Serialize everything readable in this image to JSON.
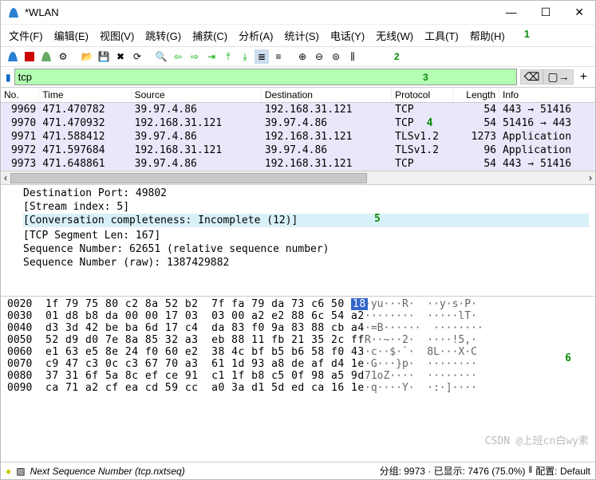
{
  "window": {
    "title": "*WLAN"
  },
  "menu": {
    "file": "文件(F)",
    "edit": "编辑(E)",
    "view": "视图(V)",
    "go": "跳转(G)",
    "capture": "捕获(C)",
    "analyze": "分析(A)",
    "stats": "统计(S)",
    "tel": "电话(Y)",
    "wireless": "无线(W)",
    "tools": "工具(T)",
    "help": "帮助(H)"
  },
  "annotations": {
    "n1": "1",
    "n2": "2",
    "n3": "3",
    "n4": "4",
    "n5": "5",
    "n6": "6"
  },
  "filter": {
    "value": "tcp"
  },
  "columns": {
    "no": "No.",
    "time": "Time",
    "src": "Source",
    "dst": "Destination",
    "proto": "Protocol",
    "len": "Length",
    "info": "Info"
  },
  "packets": [
    {
      "no": "9969",
      "time": "471.470782",
      "src": "39.97.4.86",
      "dst": "192.168.31.121",
      "proto": "TCP",
      "len": "54",
      "info": "443 → 51416"
    },
    {
      "no": "9970",
      "time": "471.470932",
      "src": "192.168.31.121",
      "dst": "39.97.4.86",
      "proto": "TCP",
      "len": "54",
      "info": "51416 → 443"
    },
    {
      "no": "9971",
      "time": "471.588412",
      "src": "39.97.4.86",
      "dst": "192.168.31.121",
      "proto": "TLSv1.2",
      "len": "1273",
      "info": "Application"
    },
    {
      "no": "9972",
      "time": "471.597684",
      "src": "192.168.31.121",
      "dst": "39.97.4.86",
      "proto": "TLSv1.2",
      "len": "96",
      "info": "Application"
    },
    {
      "no": "9973",
      "time": "471.648861",
      "src": "39.97.4.86",
      "dst": "192.168.31.121",
      "proto": "TCP",
      "len": "54",
      "info": "443 → 51416"
    }
  ],
  "details": {
    "l0": "Destination Port: 49802",
    "l1": "[Stream index: 5]",
    "l2": "[Conversation completeness: Incomplete (12)]",
    "l3": "[TCP Segment Len: 167]",
    "l4": "Sequence Number: 62651    (relative sequence number)",
    "l5": "Sequence Number (raw): 1387429882"
  },
  "hex": [
    {
      "off": "0020",
      "b": "1f 79 75 80 c2 8a 52 b2  7f fa 79 da 73 c6 50 18",
      "a": "·yu···R·  ··y·s·P·"
    },
    {
      "off": "0030",
      "b": "01 d8 b8 da 00 00 17 03  03 00 a2 e2 88 6c 54 a2",
      "a": "········  ·····lT·"
    },
    {
      "off": "0040",
      "b": "d3 3d 42 be ba 6d 17 c4  da 83 f0 9a 83 88 cb a4",
      "a": "·=B······  ········"
    },
    {
      "off": "0050",
      "b": "52 d9 d0 7e 8a 85 32 a3  eb 88 11 fb 21 35 2c ff",
      "a": "R··~··2·  ····!5,·"
    },
    {
      "off": "0060",
      "b": "e1 63 e5 8e 24 f0 60 e2  38 4c bf b5 b6 58 f0 43",
      "a": "·c··$·`·  8L···X·C"
    },
    {
      "off": "0070",
      "b": "c9 47 c3 0c c3 67 70 a3  61 1d 93 a8 de af d4 1e",
      "a": "·G···}p·  ········"
    },
    {
      "off": "0080",
      "b": "37 31 6f 5a 8c ef ce 91  c1 1f b8 c5 0f 98 a5 9d",
      "a": "71oZ····  ········"
    },
    {
      "off": "0090",
      "b": "ca 71 a2 cf ea cd 59 cc  a0 3a d1 5d ed ca 16 1e",
      "a": "·q····Y·  ·:·]····"
    }
  ],
  "hex_sel": "18",
  "status": {
    "left": "Next Sequence Number (tcp.nxtseq)",
    "pkts": "分组: 9973 · 已显示: 7476 (75.0%)",
    "profile": "配置: Default"
  },
  "watermark": "CSDN @上班cn白wy素"
}
